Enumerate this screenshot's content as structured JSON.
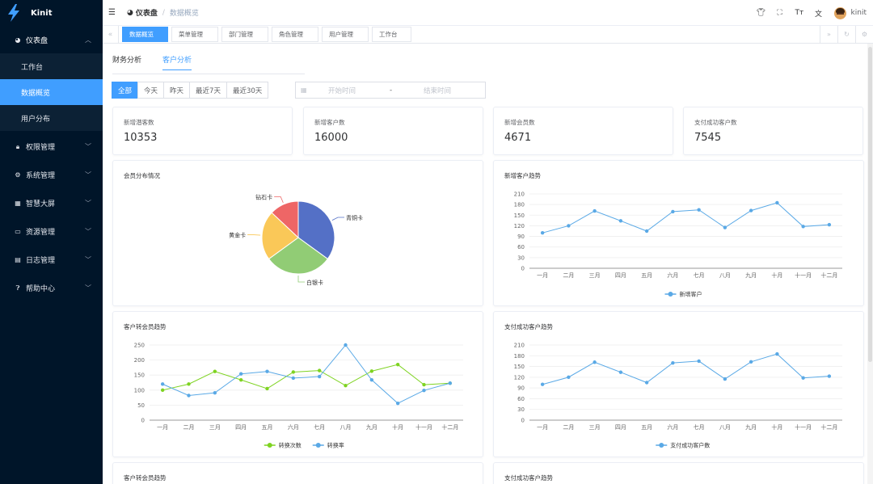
{
  "app": {
    "name": "Kinit"
  },
  "sidebar": {
    "groups": [
      {
        "label": "仪表盘",
        "icon": "dashboard-icon",
        "open": true,
        "items": [
          {
            "label": "工作台"
          },
          {
            "label": "数据概览",
            "active": true
          },
          {
            "label": "用户分布"
          }
        ]
      },
      {
        "label": "权限管理",
        "icon": "lock-icon"
      },
      {
        "label": "系统管理",
        "icon": "gear-icon"
      },
      {
        "label": "智慧大屏",
        "icon": "screen-icon"
      },
      {
        "label": "资源管理",
        "icon": "resource-icon"
      },
      {
        "label": "日志管理",
        "icon": "log-icon"
      },
      {
        "label": "帮助中心",
        "icon": "help-icon"
      }
    ]
  },
  "header": {
    "breadcrumb": [
      "仪表盘",
      "数据概览"
    ],
    "icons": [
      "shirt-icon",
      "fullscreen-icon",
      "font-size-icon",
      "translate-icon"
    ],
    "username": "kinit"
  },
  "tags": [
    "数据概览",
    "菜单管理",
    "部门管理",
    "角色管理",
    "用户管理",
    "工作台"
  ],
  "tabs": [
    "财务分析",
    "客户分析"
  ],
  "active_tab": 1,
  "filter": {
    "buttons": [
      "全部",
      "今天",
      "昨天",
      "最近7天",
      "最近30天"
    ],
    "active": 0,
    "start_placeholder": "开始时间",
    "end_placeholder": "结束时间",
    "separator": "-"
  },
  "stats": [
    {
      "label": "新增潜客数",
      "value": "10353"
    },
    {
      "label": "新增客户数",
      "value": "16000"
    },
    {
      "label": "新增会员数",
      "value": "4671"
    },
    {
      "label": "支付成功客户数",
      "value": "7545"
    }
  ],
  "colors": {
    "accent": "#409eff",
    "sidebar": "#001529",
    "line_blue": "#5aa9e6",
    "line_green": "#7ed321"
  },
  "chart_data": [
    {
      "id": "member-pie",
      "type": "pie",
      "title": "会员分布情况",
      "slices": [
        {
          "name": "青铜卡",
          "value": 35,
          "color": "#5470c6"
        },
        {
          "name": "白银卡",
          "value": 30,
          "color": "#91cc75"
        },
        {
          "name": "黄金卡",
          "value": 22,
          "color": "#fac858"
        },
        {
          "name": "钻石卡",
          "value": 13,
          "color": "#ee6666"
        }
      ]
    },
    {
      "id": "new-customer-trend",
      "type": "line",
      "title": "新增客户趋势",
      "categories": [
        "一月",
        "二月",
        "三月",
        "四月",
        "五月",
        "六月",
        "七月",
        "八月",
        "九月",
        "十月",
        "十一月",
        "十二月"
      ],
      "ylim": [
        0,
        210
      ],
      "yticks": [
        0,
        30,
        60,
        90,
        120,
        150,
        180,
        210
      ],
      "series": [
        {
          "name": "新增客户",
          "color": "#5aa9e6",
          "values": [
            100,
            120,
            162,
            134,
            105,
            160,
            165,
            115,
            163,
            185,
            118,
            123
          ]
        }
      ]
    },
    {
      "id": "conversion-trend",
      "type": "line",
      "title": "客户转会员趋势",
      "categories": [
        "一月",
        "二月",
        "三月",
        "四月",
        "五月",
        "六月",
        "七月",
        "八月",
        "九月",
        "十月",
        "十一月",
        "十二月"
      ],
      "ylim": [
        0,
        250
      ],
      "yticks": [
        0,
        50,
        100,
        150,
        200,
        250
      ],
      "series": [
        {
          "name": "转换次数",
          "color": "#7ed321",
          "values": [
            100,
            120,
            162,
            134,
            105,
            160,
            165,
            115,
            163,
            185,
            118,
            123
          ]
        },
        {
          "name": "转换率",
          "color": "#5aa9e6",
          "values": [
            120,
            82,
            91,
            154,
            162,
            140,
            145,
            250,
            134,
            56,
            99,
            123
          ]
        }
      ]
    },
    {
      "id": "paid-customer-trend",
      "type": "line",
      "title": "支付成功客户趋势",
      "categories": [
        "一月",
        "二月",
        "三月",
        "四月",
        "五月",
        "六月",
        "七月",
        "八月",
        "九月",
        "十月",
        "十一月",
        "十二月"
      ],
      "ylim": [
        0,
        210
      ],
      "yticks": [
        0,
        30,
        60,
        90,
        120,
        150,
        180,
        210
      ],
      "series": [
        {
          "name": "支付成功客户数",
          "color": "#5aa9e6",
          "values": [
            100,
            120,
            162,
            134,
            105,
            160,
            165,
            115,
            163,
            185,
            118,
            123
          ]
        }
      ]
    }
  ],
  "bottom_cards": [
    "客户转会员趋势",
    "支付成功客户趋势"
  ]
}
